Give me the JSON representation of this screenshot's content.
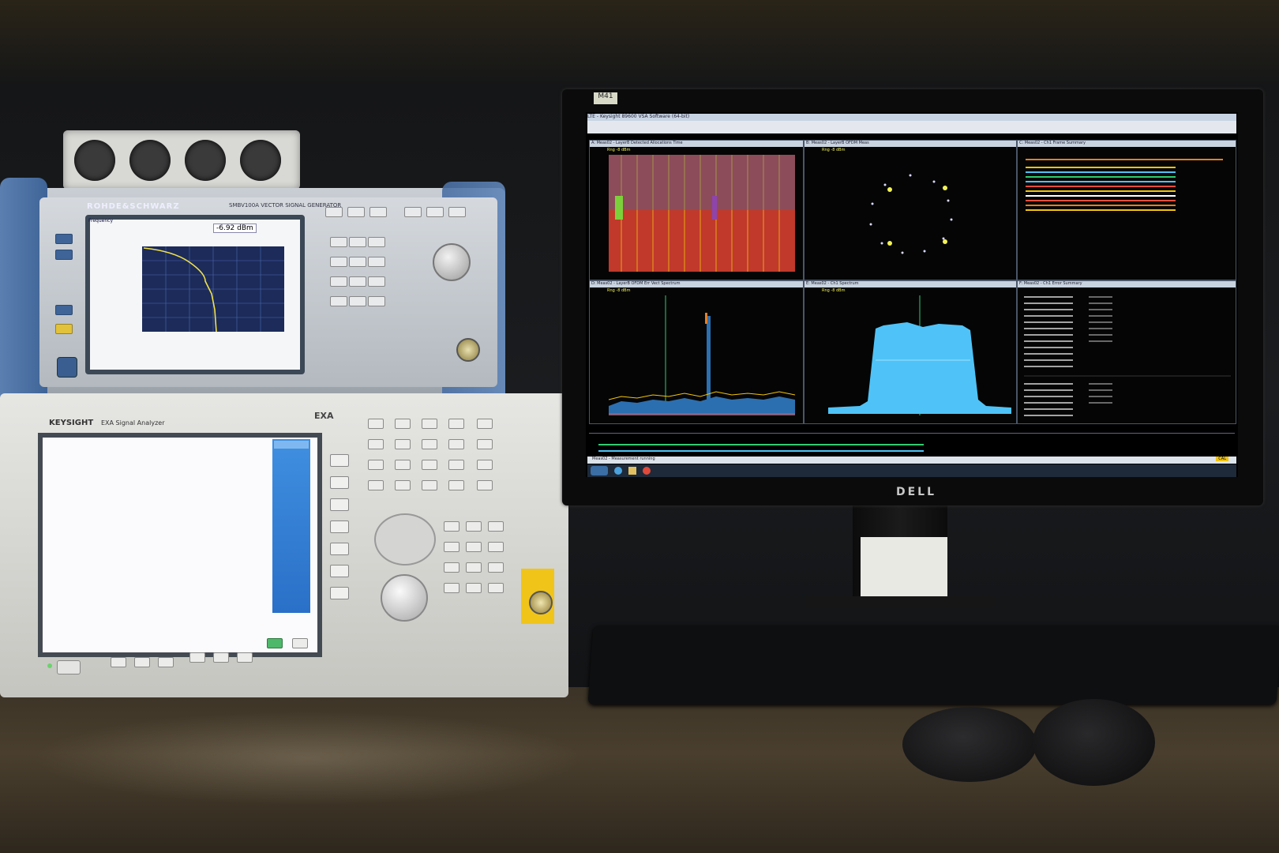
{
  "rs": {
    "brand": "ROHDE&SCHWARZ",
    "model": "SMBV100A  VECTOR SIGNAL GENERATOR",
    "screen_title": "Frequency",
    "level": "-6.92 dBm"
  },
  "exa": {
    "brand": "KEYSIGHT",
    "model": "EXA Signal Analyzer",
    "tag": "EXA"
  },
  "monitor": {
    "brand": "DELL",
    "sticker": "M41",
    "window_title": "LTE - Keysight 89600 VSA Software (64-bit)",
    "panes": [
      {
        "title": "A: Meas02 - LayerB Detected Allocations Time",
        "sub": "Rng -8 dBm"
      },
      {
        "title": "B: Meas02 - LayerB OFDM Meas",
        "sub": "Rng -8 dBm"
      },
      {
        "title": "C: Meas02 - Ch1 Frame Summary",
        "sub": ""
      },
      {
        "title": "D: Meas02 - LayerB OFDM Err Vect Spectrum",
        "sub": "Rng -8 dBm"
      },
      {
        "title": "E: Meas02 - Ch1 Spectrum",
        "sub": "Rng -8 dBm"
      },
      {
        "title": "F: Meas02 - Ch1 Error Summary",
        "sub": ""
      }
    ],
    "status": "Meas02 - Measurement running",
    "cal": "CAL"
  },
  "colors": {
    "rs_blue": "#4a6fa3",
    "exa_blue": "#2a70c8",
    "trace_cyan": "#4fc3f7",
    "alloc_red": "#c0392b"
  }
}
